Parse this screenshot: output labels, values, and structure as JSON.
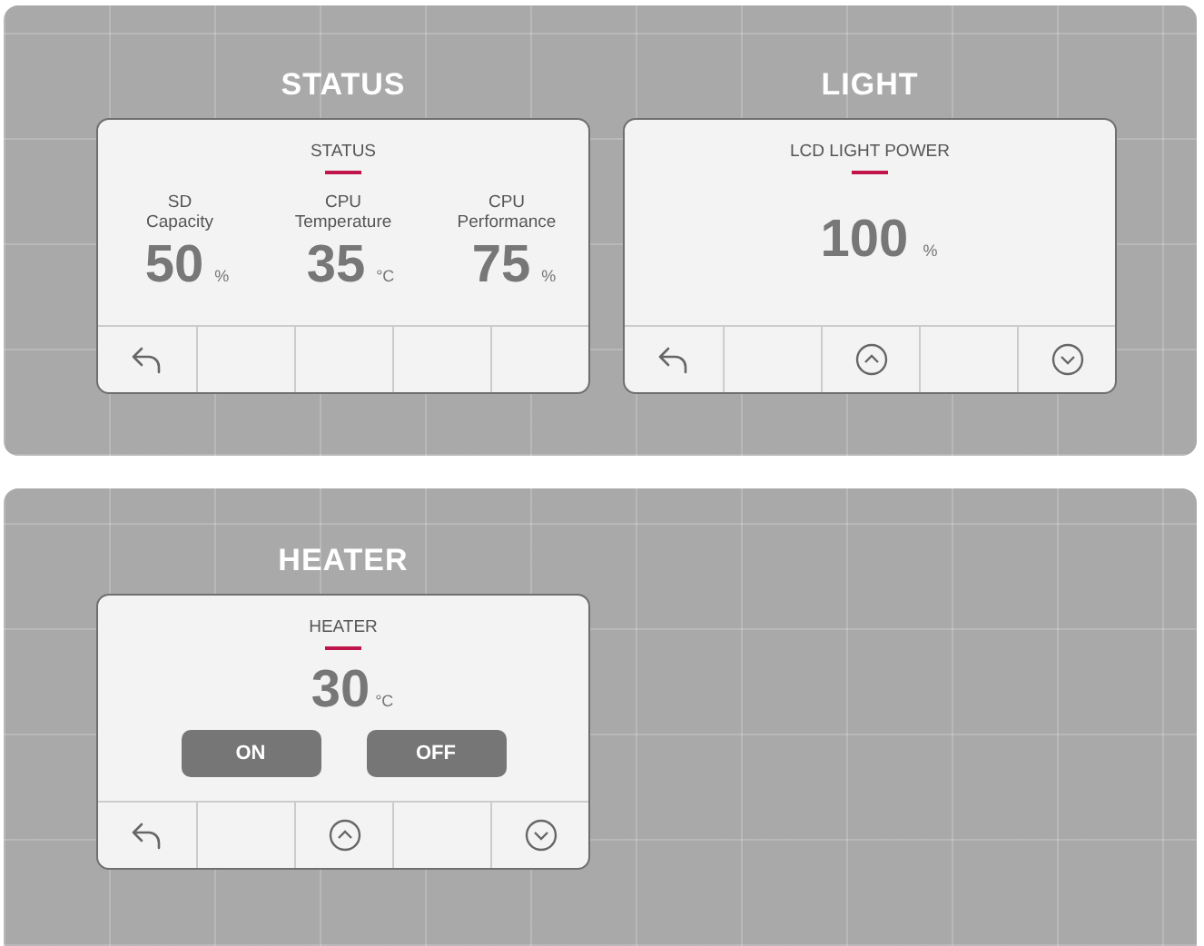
{
  "panels": [
    {
      "screens": [
        {
          "heading": "STATUS",
          "title": "STATUS",
          "kind": "readings",
          "readings": [
            {
              "label": "SD\nCapacity",
              "value": "50",
              "unit": "%"
            },
            {
              "label": "CPU\nTemperature",
              "value": "35",
              "unit": "°C"
            },
            {
              "label": "CPU\nPerformance",
              "value": "75",
              "unit": "%"
            }
          ],
          "keys": [
            {
              "kind": "back"
            },
            {
              "kind": "blank"
            },
            {
              "kind": "blank"
            },
            {
              "kind": "blank"
            },
            {
              "kind": "blank"
            }
          ]
        },
        {
          "heading": "LIGHT",
          "title": "LCD LIGHT POWER",
          "kind": "value",
          "value": "100",
          "unit": "%",
          "keys": [
            {
              "kind": "back"
            },
            {
              "kind": "blank"
            },
            {
              "kind": "up"
            },
            {
              "kind": "blank"
            },
            {
              "kind": "down"
            }
          ]
        }
      ]
    },
    {
      "screens": [
        {
          "heading": "HEATER",
          "title": "HEATER",
          "kind": "switch",
          "value": "30",
          "unit": "°C",
          "buttons": [
            "ON",
            "OFF"
          ],
          "keys": [
            {
              "kind": "back"
            },
            {
              "kind": "blank"
            },
            {
              "kind": "up"
            },
            {
              "kind": "blank"
            },
            {
              "kind": "down"
            }
          ]
        }
      ]
    }
  ]
}
